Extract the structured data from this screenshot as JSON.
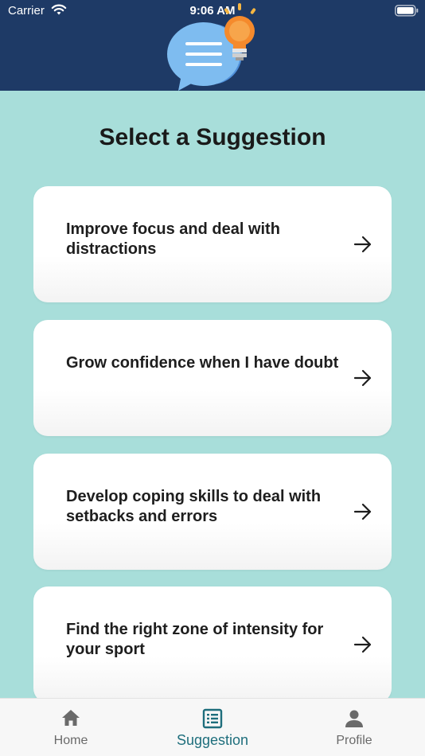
{
  "status_bar": {
    "carrier": "Carrier",
    "time": "9:06 AM"
  },
  "header": {
    "logo_icon": "chat-bubble-lightbulb-icon",
    "background": "#1E3A66"
  },
  "page": {
    "title": "Select a Suggestion",
    "background": "#A8DEDA"
  },
  "suggestions": [
    {
      "label": "Improve focus and deal with distractions",
      "icon": "arrow-right-icon"
    },
    {
      "label": "Grow confidence when I have doubt",
      "icon": "arrow-right-icon"
    },
    {
      "label": "Develop coping skills to deal with setbacks and errors",
      "icon": "arrow-right-icon"
    },
    {
      "label": "Find the right zone of intensity for your sport",
      "icon": "arrow-right-icon"
    }
  ],
  "bottom_nav": {
    "active": "Suggestion",
    "accent": "#1E6E7C",
    "items": [
      {
        "label": "Home",
        "icon": "home-icon"
      },
      {
        "label": "Suggestion",
        "icon": "list-icon"
      },
      {
        "label": "Profile",
        "icon": "person-icon"
      }
    ]
  }
}
